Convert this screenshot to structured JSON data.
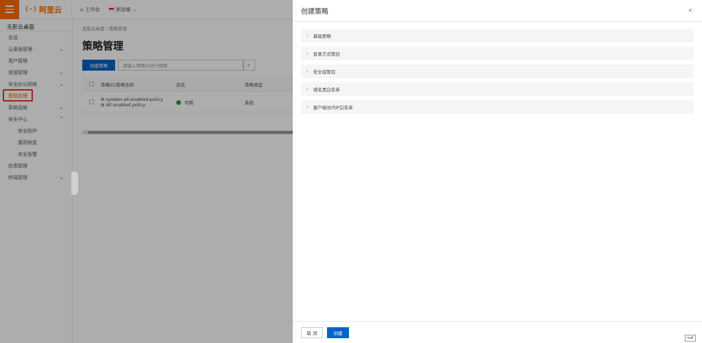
{
  "topbar": {
    "logo_text": "阿里云",
    "logo_mark": "(-)",
    "workbench": "工作台",
    "region": "新加坡"
  },
  "sidebar": {
    "title": "无影云桌面",
    "items": [
      {
        "label": "总览"
      },
      {
        "label": "云桌面管理"
      },
      {
        "label": "用户管理"
      },
      {
        "label": "资源管理"
      },
      {
        "label": "安全办公网络"
      },
      {
        "label": "策略管理"
      },
      {
        "label": "系统运维"
      },
      {
        "label": "安全中心"
      },
      {
        "label": "安全防护"
      },
      {
        "label": "漏洞修复"
      },
      {
        "label": "安全告警"
      },
      {
        "label": "应用管理"
      },
      {
        "label": "终端管理"
      }
    ]
  },
  "main": {
    "breadcrumb": "无影云桌面 / 策略管理",
    "title": "策略管理",
    "create_button": "创建策略",
    "search_placeholder": "请输入策略ID进行搜索",
    "table": {
      "headers": [
        "策略ID/策略名称",
        "状态",
        "策略类型"
      ],
      "rows": [
        {
          "id": "system-all-enabled-policy",
          "name": "All enabled policy",
          "status": "可用",
          "type": "系统"
        }
      ]
    }
  },
  "drawer": {
    "title": "创建策略",
    "sections": [
      "基础策略",
      "登录方式管控",
      "安全组管控",
      "域名黑白名单",
      "客户端访问IP白名单"
    ],
    "cancel": "取 消",
    "create": "创建"
  },
  "badge": "null"
}
